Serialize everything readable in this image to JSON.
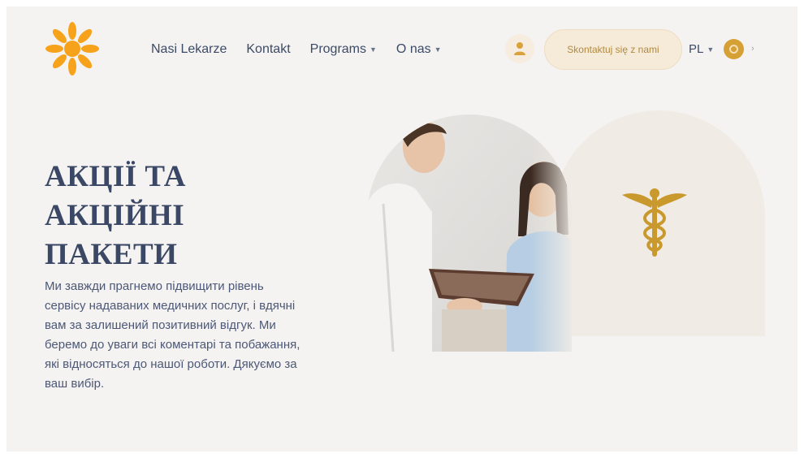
{
  "header": {
    "nav": [
      {
        "label": "Nasi Lekarze",
        "dropdown": false
      },
      {
        "label": "Kontakt",
        "dropdown": false
      },
      {
        "label": "Programs",
        "dropdown": true
      },
      {
        "label": "O nas",
        "dropdown": true
      }
    ],
    "cta_label": "Skontaktuj się z nami",
    "language": "PL",
    "icons": {
      "user": "user-icon",
      "currency": "coin-icon",
      "logo": "sun-logo-icon"
    }
  },
  "hero": {
    "title": "АКЦІЇ ТА АКЦІЙНІ ПАКЕТИ",
    "description": "Ми завжди прагнемо підвищити рівень сервісу надаваних медичних послуг, і вдячні вам за залишений позитивний відгук. Ми беремо до уваги всі коментарі та побажання, які відносяться до нашої роботи. Дякуємо за ваш вибір."
  },
  "colors": {
    "accent": "#f5a623",
    "gold": "#c9992e",
    "text": "#3a4765",
    "background": "#f5f3f1"
  }
}
